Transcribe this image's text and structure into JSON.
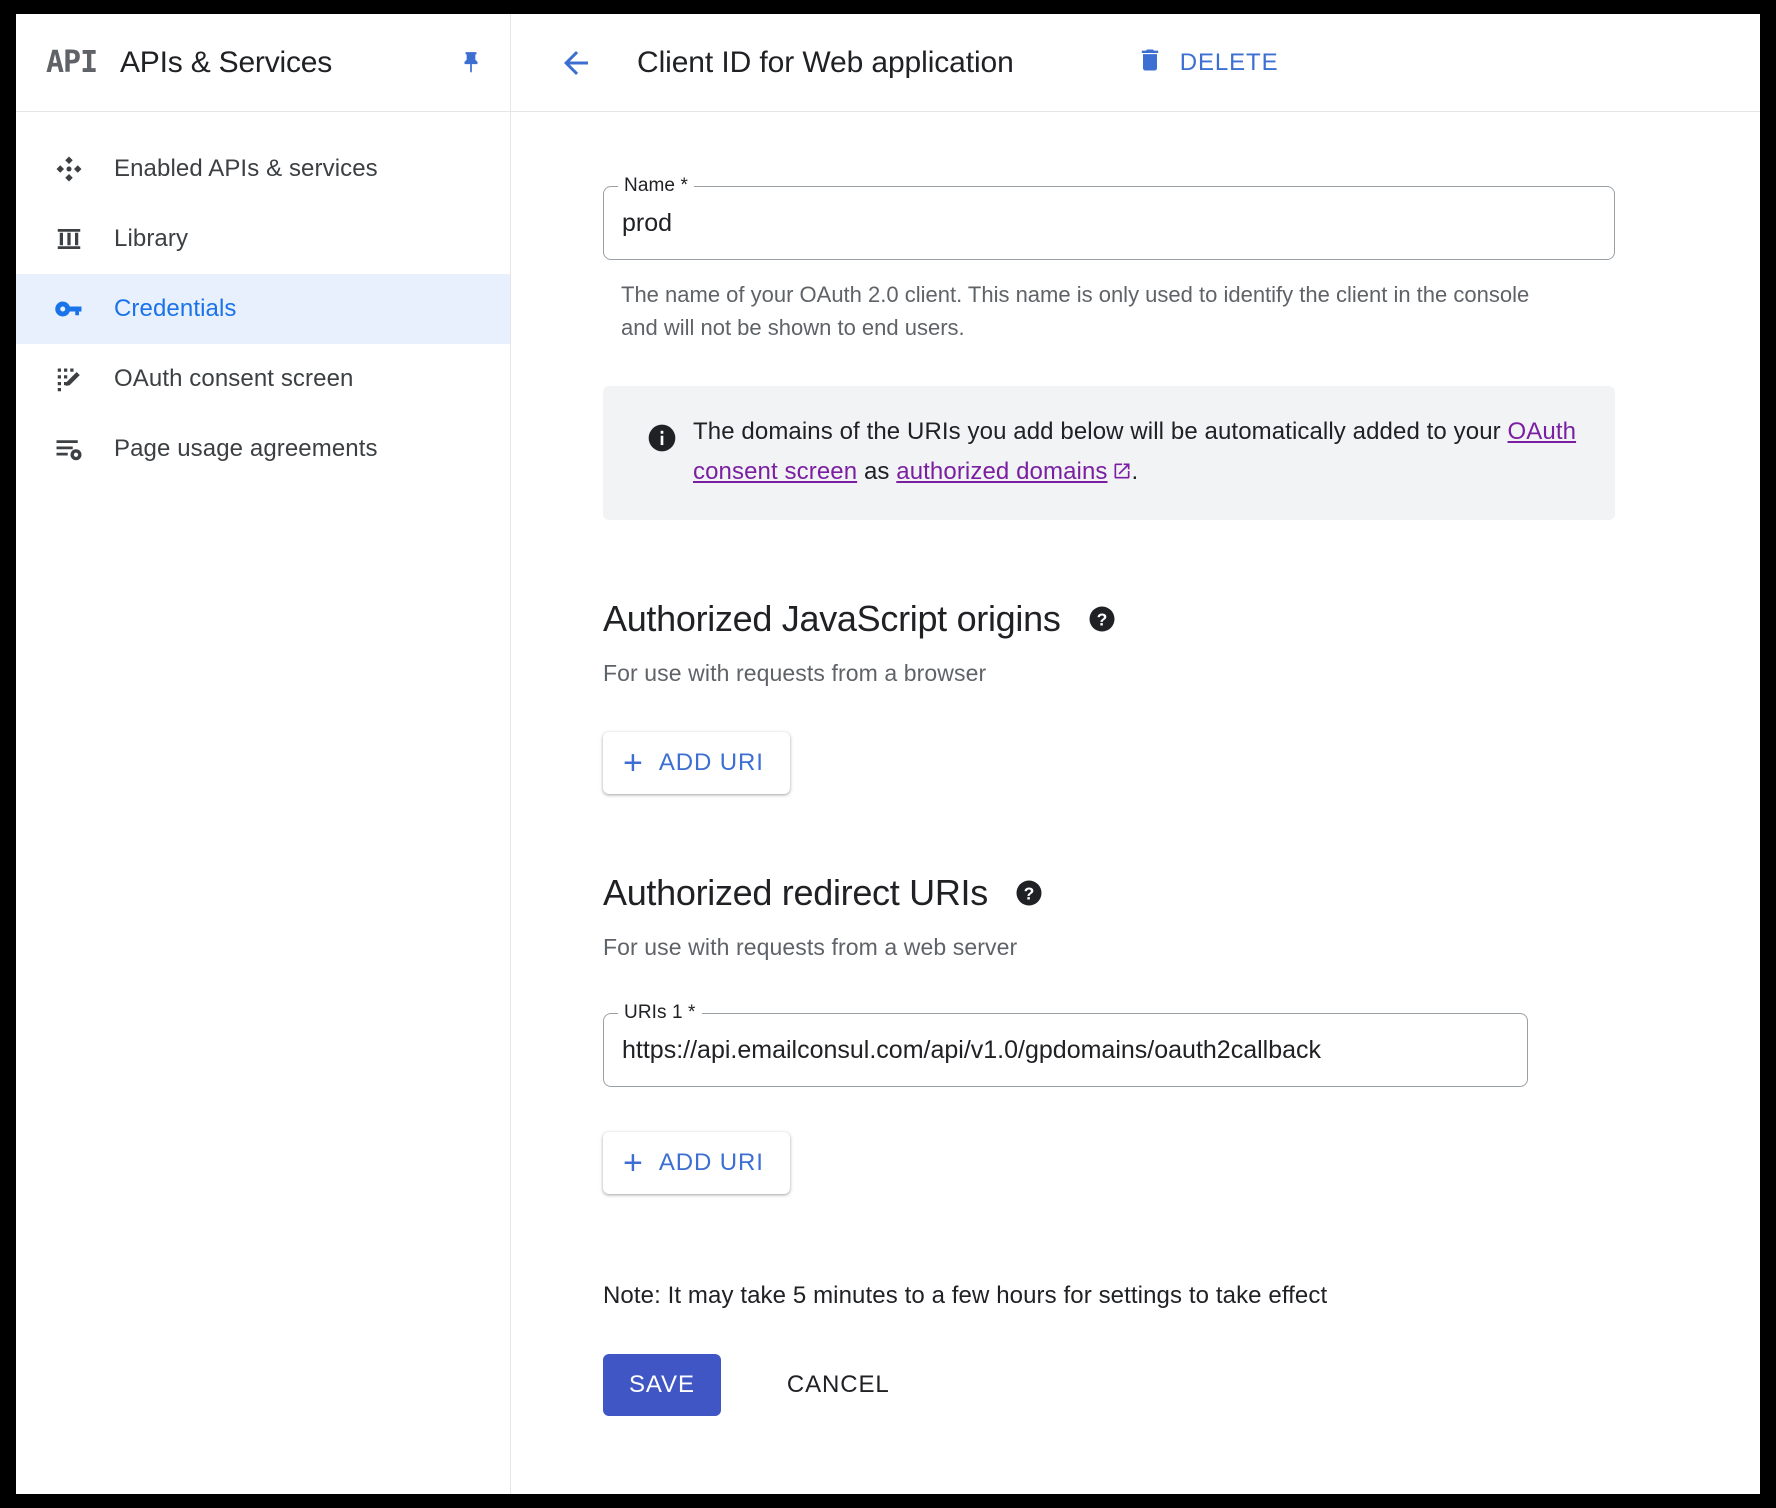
{
  "sidebar": {
    "logo_text": "API",
    "title": "APIs & Services",
    "pin_icon": "pin-icon",
    "items": [
      {
        "label": "Enabled APIs & services",
        "icon": "dashboard-diamond-icon",
        "active": false
      },
      {
        "label": "Library",
        "icon": "library-icon",
        "active": false
      },
      {
        "label": "Credentials",
        "icon": "key-icon",
        "active": true
      },
      {
        "label": "OAuth consent screen",
        "icon": "consent-screen-icon",
        "active": false
      },
      {
        "label": "Page usage agreements",
        "icon": "agreements-icon",
        "active": false
      }
    ]
  },
  "header": {
    "back_icon": "arrow-left-icon",
    "title": "Client ID for Web application",
    "delete_icon": "trash-icon",
    "delete_label": "DELETE"
  },
  "form": {
    "name_field": {
      "legend": "Name *",
      "value": "prod",
      "placeholder": "Name"
    },
    "name_helper": "The name of your OAuth 2.0 client. This name is only used to identify the client in the console and will not be shown to end users.",
    "banner": {
      "icon": "info-icon",
      "text_part1": "The domains of the URIs you add below will be automatically added to your ",
      "link1": "OAuth consent screen",
      "text_part2": " as ",
      "link2": "authorized domains",
      "external_icon": "external-link-icon",
      "text_part3": "."
    },
    "js_origins": {
      "title": "Authorized JavaScript origins",
      "help_icon": "help-circle-icon",
      "subtitle": "For use with requests from a browser",
      "add_uri_label": "ADD URI",
      "add_uri_icon": "plus-icon"
    },
    "redirect_uris": {
      "title": "Authorized redirect URIs",
      "help_icon": "help-circle-icon",
      "subtitle": "For use with requests from a web server",
      "uri_1": {
        "legend": "URIs 1 *",
        "value": "https://api.emailconsul.com/api/v1.0/gpdomains/oauth2callback",
        "placeholder": "URIs 1"
      },
      "add_uri_label": "ADD URI",
      "add_uri_icon": "plus-icon"
    },
    "note": "Note: It may take 5 minutes to a few hours for settings to take effect",
    "save_label": "SAVE",
    "cancel_label": "CANCEL"
  },
  "colors": {
    "accent_blue": "#1a73e8",
    "button_blue": "#4156c5",
    "link_purple": "#7b1fa2",
    "active_bg": "#e8f0fe",
    "banner_bg": "#f1f3f4",
    "text_primary": "#202124",
    "text_secondary": "#5f6368"
  }
}
